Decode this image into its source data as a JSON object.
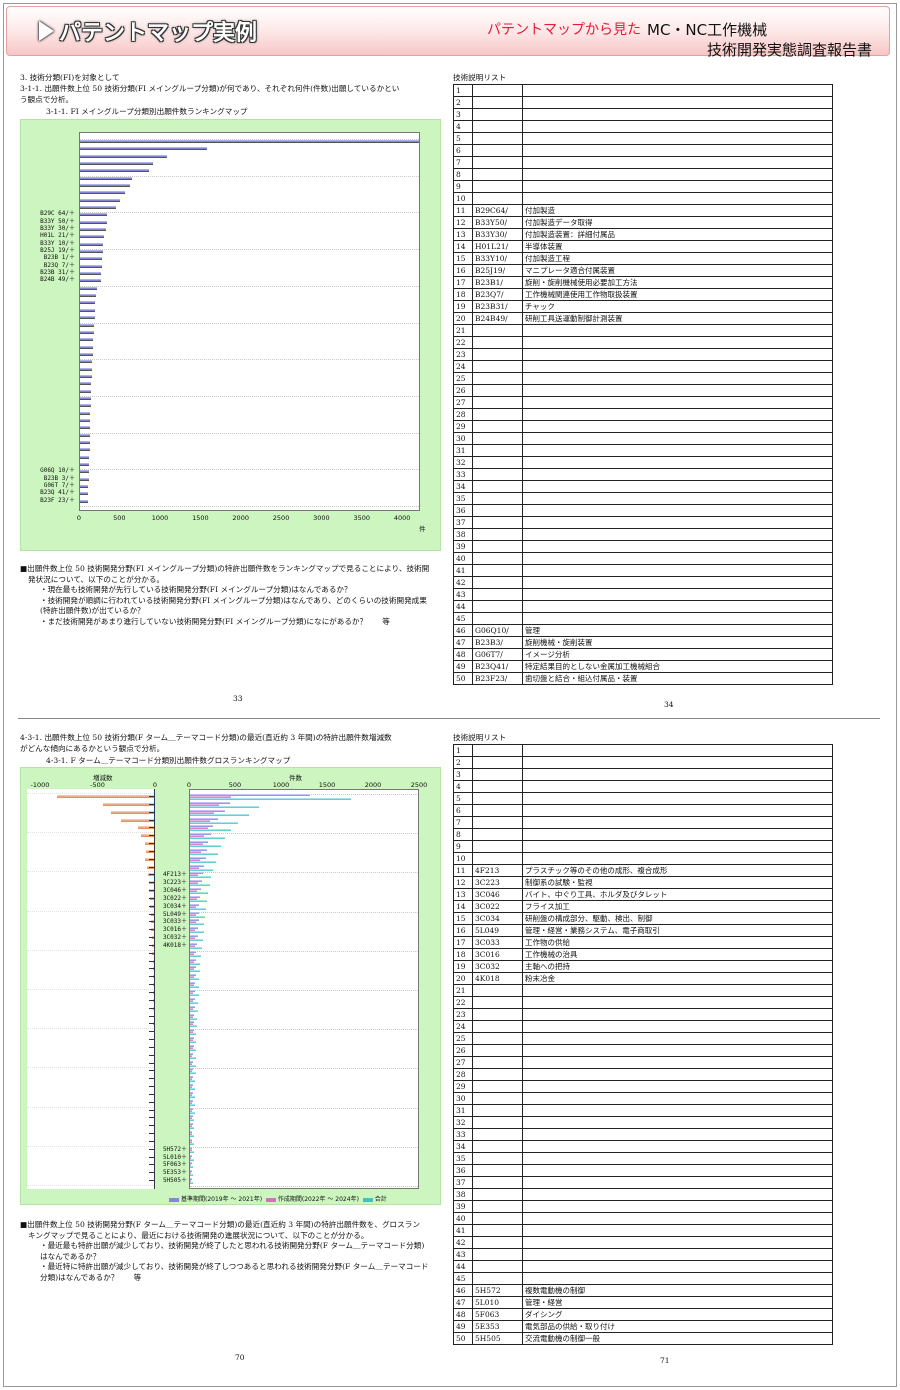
{
  "banner": {
    "title": "パテントマップ実例",
    "sub1": "パテントマップから見た",
    "sub2": "MC・NC工作機械",
    "sub3": "技術開発実態調査報告書"
  },
  "top": {
    "heading1": "3. 技術分類(FI)を対象として",
    "heading2": "3-1-1. 出願件数上位 50 技術分類(FI メイングループ分類)が何であり、それぞれ何件(件数)出願しているかとい",
    "heading3": "う観点で分析。",
    "caption": "3-1-1. FI メイングループ分類別出願件数ランキングマップ",
    "unit": "件",
    "notes": [
      "■出願件数上位 50 技術開発分野(FI メイングループ分類)の特許出願件数をランキングマップで見ることにより、技術開",
      "発状況について、以下のことが分かる。",
      "・現在最も技術開発が先行している技術開発分野(FI メイングループ分類)はなんであるか？",
      "・技術開発が順調に行われている技術開発分野(FI メイングループ分類)はなんであり、どのくらいの技術開発成果",
      "(特許出願件数)が出ているか？",
      "・まだ技術開発があまり進行していない技術開発分野(FI メイングループ分類)になにがあるか？　　等"
    ],
    "page_left": "33",
    "page_right": "34",
    "list_title": "技術説明リスト"
  },
  "bottom": {
    "heading1": "4-3-1. 出願件数上位 50 技術分類(F ターム＿テーマコード分類)の最近(直近約 3 年間)の特許出願件数増減数",
    "heading2": "がどんな傾向にあるかという観点で分析。",
    "caption": "4-3-1. F ターム＿テーマコード分類別出願件数グロスランキングマップ",
    "left_axis_label": "増減数",
    "right_axis_label": "件数",
    "legend": [
      "基準期間(2019年 ～ 2021年)",
      "作成期間(2022年 ～ 2024年)",
      "合計"
    ],
    "notes": [
      "■出願件数上位 50 技術開発分野(F ターム＿テーマコード分類)の最近(直近約 3 年間)の特許出願件数を、グロスラン",
      "キングマップで見ることにより、最近における技術開発の進展状況について、以下のことが分かる。",
      "・最近最も特許出願が減少しており、技術開発が終了したと思われる技術開発分野(F ターム＿テーマコード分類)",
      "はなんであるか？",
      "・最近特に特許出願が減少しており、技術開発が終了しつつあると思われる技術開発分野(F ターム＿テーマコード",
      "分類)はなんであるか？　　等"
    ],
    "page_left": "70",
    "page_right": "71",
    "list_title": "技術説明リスト"
  },
  "chart_data": [
    {
      "type": "bar",
      "title": "3-1-1. FI メイングループ分類別出願件数ランキングマップ",
      "xlabel": "件",
      "xlim": [
        0,
        4200
      ],
      "xticks": [
        0,
        500,
        1000,
        1500,
        2000,
        2500,
        3000,
        3500,
        4000
      ],
      "labeled_categories": [
        {
          "rank": 11,
          "label": "B29C 64/＋"
        },
        {
          "rank": 12,
          "label": "B33Y 50/＋"
        },
        {
          "rank": 13,
          "label": "B33Y 30/＋"
        },
        {
          "rank": 14,
          "label": "H01L 21/＋"
        },
        {
          "rank": 15,
          "label": "B33Y 10/＋"
        },
        {
          "rank": 16,
          "label": "B25J 19/＋"
        },
        {
          "rank": 17,
          "label": "B23B  1/＋"
        },
        {
          "rank": 18,
          "label": "B23Q  7/＋"
        },
        {
          "rank": 19,
          "label": "B23B 31/＋"
        },
        {
          "rank": 20,
          "label": "B24B 49/＋"
        },
        {
          "rank": 46,
          "label": "G06Q 10/＋"
        },
        {
          "rank": 47,
          "label": "B23B  3/＋"
        },
        {
          "rank": 48,
          "label": "G06T  7/＋"
        },
        {
          "rank": 49,
          "label": "B23Q 41/＋"
        },
        {
          "rank": 50,
          "label": "B23F 23/＋"
        }
      ],
      "values": [
        4200,
        1570,
        1080,
        910,
        850,
        640,
        620,
        560,
        500,
        450,
        340,
        330,
        320,
        300,
        290,
        285,
        275,
        270,
        265,
        260,
        210,
        200,
        190,
        185,
        180,
        175,
        170,
        165,
        160,
        155,
        150,
        148,
        145,
        140,
        138,
        135,
        132,
        130,
        128,
        125,
        122,
        120,
        118,
        115,
        112,
        110,
        108,
        105,
        102,
        100
      ]
    },
    {
      "type": "bar",
      "title": "4-3-1. F ターム＿テーマコード分類別出願件数グロスランキングマップ",
      "xlabel": "件数",
      "xlim": [
        0,
        2500
      ],
      "xticks": [
        0,
        500,
        1000,
        1500,
        2000,
        2500
      ],
      "left_xticks": [
        -1000,
        -500,
        0
      ],
      "labeled_categories": [
        {
          "rank": 11,
          "label": "4F213＋"
        },
        {
          "rank": 12,
          "label": "3C223＋"
        },
        {
          "rank": 13,
          "label": "3C046＋"
        },
        {
          "rank": 14,
          "label": "3C022＋"
        },
        {
          "rank": 15,
          "label": "3C034＋"
        },
        {
          "rank": 16,
          "label": "5L049＋"
        },
        {
          "rank": 17,
          "label": "3C033＋"
        },
        {
          "rank": 18,
          "label": "3C016＋"
        },
        {
          "rank": 19,
          "label": "3C032＋"
        },
        {
          "rank": 20,
          "label": "4K018＋"
        },
        {
          "rank": 46,
          "label": "5H572＋"
        },
        {
          "rank": 47,
          "label": "5L010＋"
        },
        {
          "rank": 48,
          "label": "5F063＋"
        },
        {
          "rank": 49,
          "label": "5E353＋"
        },
        {
          "rank": 50,
          "label": "5H505＋"
        }
      ],
      "series": [
        {
          "name": "基準期間(2019年 ～ 2021年)",
          "values": [
            1300,
            430,
            380,
            300,
            250,
            230,
            200,
            180,
            170,
            150,
            140,
            130,
            120,
            110,
            100,
            100,
            95,
            90,
            85,
            80,
            70,
            65,
            60,
            60,
            55,
            55,
            50,
            50,
            45,
            45,
            40,
            40,
            40,
            38,
            36,
            35,
            34,
            33,
            32,
            30,
            30,
            28,
            28,
            26,
            26,
            25,
            24,
            23,
            22,
            20
          ]
        },
        {
          "name": "作成期間(2022年 ～ 2024年)",
          "values": [
            450,
            320,
            260,
            220,
            200,
            150,
            140,
            120,
            110,
            100,
            90,
            85,
            80,
            75,
            70,
            65,
            60,
            58,
            55,
            52,
            48,
            46,
            44,
            42,
            40,
            38,
            36,
            34,
            32,
            30,
            30,
            28,
            28,
            26,
            26,
            25,
            24,
            23,
            22,
            21,
            20,
            20,
            19,
            18,
            18,
            17,
            16,
            15,
            15,
            14
          ]
        },
        {
          "name": "合計",
          "values": [
            1750,
            750,
            640,
            520,
            450,
            380,
            340,
            300,
            280,
            250,
            230,
            215,
            200,
            185,
            170,
            165,
            155,
            148,
            140,
            132,
            118,
            111,
            104,
            102,
            95,
            93,
            86,
            84,
            77,
            75,
            70,
            68,
            68,
            64,
            62,
            60,
            58,
            56,
            54,
            51,
            50,
            48,
            47,
            44,
            44,
            42,
            40,
            38,
            37,
            34
          ]
        },
        {
          "name": "増減数",
          "values": [
            -850,
            -450,
            -380,
            -300,
            -150,
            -120,
            -90,
            -80,
            -90,
            -70,
            -60,
            -55,
            -50,
            -45,
            -40,
            -38,
            -35,
            -32,
            -30,
            -28,
            -22,
            -20,
            -18,
            -18,
            -15,
            -17,
            -14,
            -16,
            -13,
            -15,
            -10,
            -12,
            -12,
            -12,
            -10,
            -10,
            -10,
            -10,
            -10,
            -9,
            -10,
            -8,
            -9,
            -8,
            -8,
            -8,
            -8,
            -8,
            -7,
            -6
          ]
        }
      ]
    }
  ],
  "list_top": [
    {
      "no": "1",
      "code": "",
      "desc": ""
    },
    {
      "no": "2",
      "code": "",
      "desc": ""
    },
    {
      "no": "3",
      "code": "",
      "desc": ""
    },
    {
      "no": "4",
      "code": "",
      "desc": ""
    },
    {
      "no": "5",
      "code": "",
      "desc": ""
    },
    {
      "no": "6",
      "code": "",
      "desc": ""
    },
    {
      "no": "7",
      "code": "",
      "desc": ""
    },
    {
      "no": "8",
      "code": "",
      "desc": ""
    },
    {
      "no": "9",
      "code": "",
      "desc": ""
    },
    {
      "no": "10",
      "code": "",
      "desc": ""
    },
    {
      "no": "11",
      "code": "B29C64/",
      "desc": "付加製造"
    },
    {
      "no": "12",
      "code": "B33Y50/",
      "desc": "付加製造データ取得"
    },
    {
      "no": "13",
      "code": "B33Y30/",
      "desc": "付加製造装置：詳細付属品"
    },
    {
      "no": "14",
      "code": "H01L21/",
      "desc": "半導体装置"
    },
    {
      "no": "15",
      "code": "B33Y10/",
      "desc": "付加製造工程"
    },
    {
      "no": "16",
      "code": "B25J19/",
      "desc": "マニプレータ適合付属装置"
    },
    {
      "no": "17",
      "code": "B23B1/",
      "desc": "旋削・旋削機械使用必要加工方法"
    },
    {
      "no": "18",
      "code": "B23Q7/",
      "desc": "工作機械関連使用工作物取扱装置"
    },
    {
      "no": "19",
      "code": "B23B31/",
      "desc": "チャック"
    },
    {
      "no": "20",
      "code": "B24B49/",
      "desc": "研削工具送運動制御計測装置"
    },
    {
      "no": "21",
      "code": "",
      "desc": ""
    },
    {
      "no": "22",
      "code": "",
      "desc": ""
    },
    {
      "no": "23",
      "code": "",
      "desc": ""
    },
    {
      "no": "24",
      "code": "",
      "desc": ""
    },
    {
      "no": "25",
      "code": "",
      "desc": ""
    },
    {
      "no": "26",
      "code": "",
      "desc": ""
    },
    {
      "no": "27",
      "code": "",
      "desc": ""
    },
    {
      "no": "28",
      "code": "",
      "desc": ""
    },
    {
      "no": "29",
      "code": "",
      "desc": ""
    },
    {
      "no": "30",
      "code": "",
      "desc": ""
    },
    {
      "no": "31",
      "code": "",
      "desc": ""
    },
    {
      "no": "32",
      "code": "",
      "desc": ""
    },
    {
      "no": "33",
      "code": "",
      "desc": ""
    },
    {
      "no": "34",
      "code": "",
      "desc": ""
    },
    {
      "no": "35",
      "code": "",
      "desc": ""
    },
    {
      "no": "36",
      "code": "",
      "desc": ""
    },
    {
      "no": "37",
      "code": "",
      "desc": ""
    },
    {
      "no": "38",
      "code": "",
      "desc": ""
    },
    {
      "no": "39",
      "code": "",
      "desc": ""
    },
    {
      "no": "40",
      "code": "",
      "desc": ""
    },
    {
      "no": "41",
      "code": "",
      "desc": ""
    },
    {
      "no": "42",
      "code": "",
      "desc": ""
    },
    {
      "no": "43",
      "code": "",
      "desc": ""
    },
    {
      "no": "44",
      "code": "",
      "desc": ""
    },
    {
      "no": "45",
      "code": "",
      "desc": ""
    },
    {
      "no": "46",
      "code": "G06Q10/",
      "desc": "管理"
    },
    {
      "no": "47",
      "code": "B23B3/",
      "desc": "旋削機械・旋削装置"
    },
    {
      "no": "48",
      "code": "G06T7/",
      "desc": "イメージ分析"
    },
    {
      "no": "49",
      "code": "B23Q41/",
      "desc": "特定結果目的としない金属加工機械組合"
    },
    {
      "no": "50",
      "code": "B23F23/",
      "desc": "歯切盤と結合・組込付属品・装置"
    }
  ],
  "list_bottom": [
    {
      "no": "1",
      "code": "",
      "desc": ""
    },
    {
      "no": "2",
      "code": "",
      "desc": ""
    },
    {
      "no": "3",
      "code": "",
      "desc": ""
    },
    {
      "no": "4",
      "code": "",
      "desc": ""
    },
    {
      "no": "5",
      "code": "",
      "desc": ""
    },
    {
      "no": "6",
      "code": "",
      "desc": ""
    },
    {
      "no": "7",
      "code": "",
      "desc": ""
    },
    {
      "no": "8",
      "code": "",
      "desc": ""
    },
    {
      "no": "9",
      "code": "",
      "desc": ""
    },
    {
      "no": "10",
      "code": "",
      "desc": ""
    },
    {
      "no": "11",
      "code": "4F213",
      "desc": "プラスチック等のその他の成形、複合成形"
    },
    {
      "no": "12",
      "code": "3C223",
      "desc": "制御系の試験・監視"
    },
    {
      "no": "13",
      "code": "3C046",
      "desc": "バイト、中ぐり工具、ホルダ及びタレット"
    },
    {
      "no": "14",
      "code": "3C022",
      "desc": "フライス加工"
    },
    {
      "no": "15",
      "code": "3C034",
      "desc": "研削盤の構成部分、駆動、検出、制御"
    },
    {
      "no": "16",
      "code": "5L049",
      "desc": "管理・経営・業務システム、電子商取引"
    },
    {
      "no": "17",
      "code": "3C033",
      "desc": "工作物の供給"
    },
    {
      "no": "18",
      "code": "3C016",
      "desc": "工作機械の治具"
    },
    {
      "no": "19",
      "code": "3C032",
      "desc": "主軸への把持"
    },
    {
      "no": "20",
      "code": "4K018",
      "desc": "粉末冶金"
    },
    {
      "no": "21",
      "code": "",
      "desc": ""
    },
    {
      "no": "22",
      "code": "",
      "desc": ""
    },
    {
      "no": "23",
      "code": "",
      "desc": ""
    },
    {
      "no": "24",
      "code": "",
      "desc": ""
    },
    {
      "no": "25",
      "code": "",
      "desc": ""
    },
    {
      "no": "26",
      "code": "",
      "desc": ""
    },
    {
      "no": "27",
      "code": "",
      "desc": ""
    },
    {
      "no": "28",
      "code": "",
      "desc": ""
    },
    {
      "no": "29",
      "code": "",
      "desc": ""
    },
    {
      "no": "30",
      "code": "",
      "desc": ""
    },
    {
      "no": "31",
      "code": "",
      "desc": ""
    },
    {
      "no": "32",
      "code": "",
      "desc": ""
    },
    {
      "no": "33",
      "code": "",
      "desc": ""
    },
    {
      "no": "34",
      "code": "",
      "desc": ""
    },
    {
      "no": "35",
      "code": "",
      "desc": ""
    },
    {
      "no": "36",
      "code": "",
      "desc": ""
    },
    {
      "no": "37",
      "code": "",
      "desc": ""
    },
    {
      "no": "38",
      "code": "",
      "desc": ""
    },
    {
      "no": "39",
      "code": "",
      "desc": ""
    },
    {
      "no": "40",
      "code": "",
      "desc": ""
    },
    {
      "no": "41",
      "code": "",
      "desc": ""
    },
    {
      "no": "42",
      "code": "",
      "desc": ""
    },
    {
      "no": "43",
      "code": "",
      "desc": ""
    },
    {
      "no": "44",
      "code": "",
      "desc": ""
    },
    {
      "no": "45",
      "code": "",
      "desc": ""
    },
    {
      "no": "46",
      "code": "5H572",
      "desc": "複数電動機の制御"
    },
    {
      "no": "47",
      "code": "5L010",
      "desc": "管理・経営"
    },
    {
      "no": "48",
      "code": "5F063",
      "desc": "ダイシング"
    },
    {
      "no": "49",
      "code": "5E353",
      "desc": "電気部品の供給・取り付け"
    },
    {
      "no": "50",
      "code": "5H505",
      "desc": "交流電動機の制御一般"
    }
  ]
}
